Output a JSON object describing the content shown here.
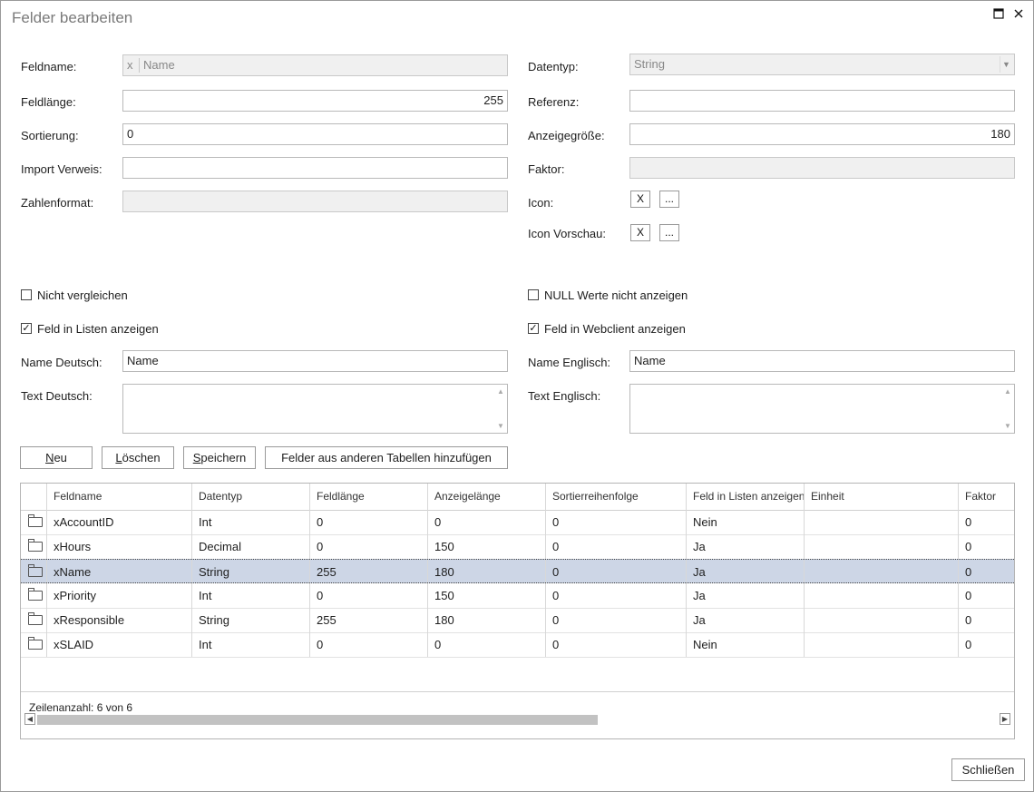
{
  "window": {
    "title": "Felder bearbeiten",
    "maximize_icon": "maximize-icon",
    "close_icon": "close-icon"
  },
  "form": {
    "feldname_label": "Feldname:",
    "feldname_prefix": "x",
    "feldname_value": "Name",
    "feldlaenge_label": "Feldlänge:",
    "feldlaenge_value": "255",
    "sortierung_label": "Sortierung:",
    "sortierung_value": "0",
    "import_label": "Import Verweis:",
    "import_value": "",
    "zahlenformat_label": "Zahlenformat:",
    "zahlenformat_value": "",
    "datentyp_label": "Datentyp:",
    "datentyp_value": "String",
    "referenz_label": "Referenz:",
    "referenz_value": "",
    "anzeige_label": "Anzeigegröße:",
    "anzeige_value": "180",
    "faktor_label": "Faktor:",
    "faktor_value": "",
    "icon_label": "Icon:",
    "icon_clear": "X",
    "icon_browse": "...",
    "iconvorschau_label": "Icon Vorschau:",
    "iconvorschau_clear": "X",
    "iconvorschau_browse": "..."
  },
  "checks": {
    "nicht_vergleichen": "Nicht vergleichen",
    "nicht_vergleichen_checked": false,
    "feld_listen": "Feld in Listen anzeigen",
    "feld_listen_checked": true,
    "null_werte": "NULL Werte nicht anzeigen",
    "null_werte_checked": false,
    "feld_webclient": "Feld in Webclient anzeigen",
    "feld_webclient_checked": true,
    "checkmark": "✓"
  },
  "names": {
    "deutsch_label": "Name Deutsch:",
    "deutsch_value": "Name",
    "englisch_label": "Name Englisch:",
    "englisch_value": "Name",
    "text_deutsch_label": "Text Deutsch:",
    "text_englisch_label": "Text Englisch:"
  },
  "buttons": {
    "neu": "Neu",
    "loeschen": "Löschen",
    "speichern": "Speichern",
    "hinzufuegen": "Felder aus anderen Tabellen hinzufügen",
    "schliessen": "Schließen"
  },
  "grid": {
    "columns": [
      "Feldname",
      "Datentyp",
      "Feldlänge",
      "Anzeigelänge",
      "Sortierreihenfolge",
      "Feld in Listen anzeigen",
      "Einheit",
      "Faktor"
    ],
    "rows": [
      [
        "xAccountID",
        "Int",
        "0",
        "0",
        "0",
        "Nein",
        "",
        "0"
      ],
      [
        "xHours",
        "Decimal",
        "0",
        "150",
        "0",
        "Ja",
        "",
        "0"
      ],
      [
        "xName",
        "String",
        "255",
        "180",
        "0",
        "Ja",
        "",
        "0"
      ],
      [
        "xPriority",
        "Int",
        "0",
        "150",
        "0",
        "Ja",
        "",
        "0"
      ],
      [
        "xResponsible",
        "String",
        "255",
        "180",
        "0",
        "Ja",
        "",
        "0"
      ],
      [
        "xSLAID",
        "Int",
        "0",
        "0",
        "0",
        "Nein",
        "",
        "0"
      ]
    ],
    "selected_row": 2,
    "row_icon": "folder-icon",
    "footer": "Zeilenanzahl: 6 von 6"
  }
}
